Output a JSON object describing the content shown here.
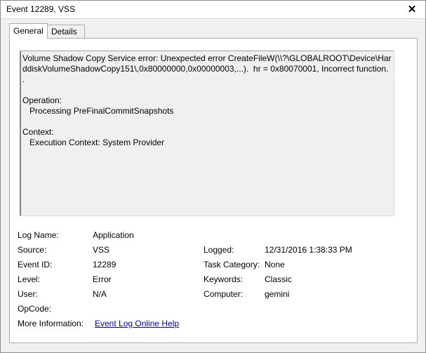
{
  "window": {
    "title": "Event 12289, VSS",
    "close_glyph": "✕"
  },
  "tabs": [
    {
      "label": "General",
      "active": true
    },
    {
      "label": "Details",
      "active": false
    }
  ],
  "description": "Volume Shadow Copy Service error: Unexpected error CreateFileW(\\\\?\\GLOBALROOT\\Device\\HarddiskVolumeShadowCopy151\\,0x80000000,0x00000003,...).  hr = 0x80070001, Incorrect function.\n.\n\nOperation:\n   Processing PreFinalCommitSnapshots\n\nContext:\n   Execution Context: System Provider",
  "fields": {
    "log_name": {
      "label": "Log Name:",
      "value": "Application"
    },
    "source": {
      "label": "Source:",
      "value": "VSS"
    },
    "logged": {
      "label": "Logged:",
      "value": "12/31/2016 1:38:33 PM"
    },
    "event_id": {
      "label": "Event ID:",
      "value": "12289"
    },
    "task_category": {
      "label": "Task Category:",
      "value": "None"
    },
    "level": {
      "label": "Level:",
      "value": "Error"
    },
    "keywords": {
      "label": "Keywords:",
      "value": "Classic"
    },
    "user": {
      "label": "User:",
      "value": "N/A"
    },
    "computer": {
      "label": "Computer:",
      "value": "gemini"
    },
    "opcode": {
      "label": "OpCode:",
      "value": ""
    },
    "more_info": {
      "label": "More Information:",
      "link": "Event Log Online Help"
    }
  },
  "colors": {
    "link": "#0000cc",
    "background": "#f0f0f0"
  }
}
